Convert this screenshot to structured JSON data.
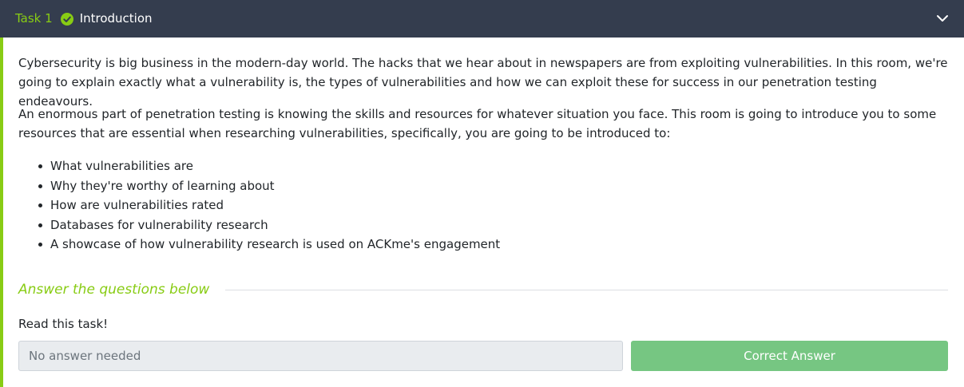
{
  "task": {
    "number_label": "Task 1",
    "title": "Introduction",
    "status_icon": "check-circle-icon",
    "toggle_icon": "chevron-down-icon"
  },
  "content": {
    "paragraphs": [
      "Cybersecurity is big business in the modern-day world. The hacks that we hear about in newspapers are from exploiting vulnerabilities. In this room, we're going to explain exactly what a vulnerability is, the types of vulnerabilities and how we can exploit these for success in our penetration testing endeavours.",
      "An enormous part of penetration testing is knowing the skills and resources for whatever situation you face. This room is going to introduce you to some resources that are essential when researching vulnerabilities, specifically, you are going to be introduced to:"
    ],
    "bullets": [
      "What vulnerabilities are",
      "Why they're worthy of learning about",
      "How are vulnerabilities rated",
      "Databases for vulnerability research",
      "A showcase of how vulnerability research is used on ACKme's engagement"
    ]
  },
  "questions": {
    "heading": "Answer the questions below",
    "items": [
      {
        "question": "Read this task!",
        "answer_placeholder": "No answer needed",
        "button_label": "Correct Answer"
      }
    ]
  },
  "colors": {
    "header_bg": "#343d4e",
    "accent": "#88cc14",
    "correct_button": "#76c682"
  }
}
